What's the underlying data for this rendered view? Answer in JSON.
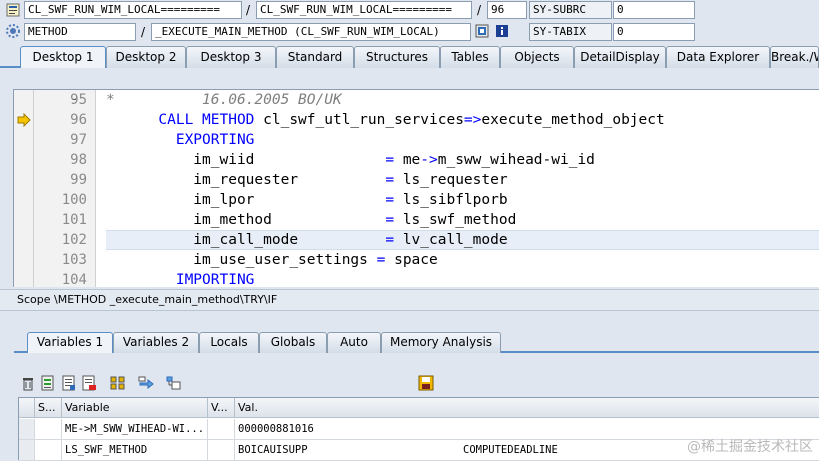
{
  "header": {
    "row1": {
      "field1": "CL_SWF_RUN_WIM_LOCAL=========",
      "sep1": "/",
      "field2": "CL_SWF_RUN_WIM_LOCAL=========",
      "sep2": "/",
      "line": "96",
      "sysvar": "SY-SUBRC",
      "sysval": "0"
    },
    "row2": {
      "type": "METHOD",
      "sep1": "/",
      "name": "_EXECUTE_MAIN_METHOD (CL_SWF_RUN_WIM_LOCAL)",
      "sysvar": "SY-TABIX",
      "sysval": "0"
    }
  },
  "desktop_tabs": [
    "Desktop 1",
    "Desktop 2",
    "Desktop 3",
    "Standard",
    "Structures",
    "Tables",
    "Objects",
    "DetailDisplay",
    "Data Explorer",
    "Break./W"
  ],
  "editor": {
    "lines": [
      {
        "num": "95",
        "marker": "-",
        "parts": [
          {
            "t": "*          16.06.2005 BO/UK",
            "c": "cm"
          }
        ]
      },
      {
        "num": "96",
        "marker": "",
        "parts": [
          {
            "t": "      CALL METHOD",
            "c": "kw"
          },
          {
            "t": " cl_swf_utl_run_services",
            "c": ""
          },
          {
            "t": "=>",
            "c": "op"
          },
          {
            "t": "execute_method_object",
            "c": ""
          }
        ]
      },
      {
        "num": "97",
        "marker": "",
        "parts": [
          {
            "t": "        EXPORTING",
            "c": "kw"
          }
        ]
      },
      {
        "num": "98",
        "marker": "",
        "parts": [
          {
            "t": "          im_wiid               ",
            "c": ""
          },
          {
            "t": "=",
            "c": "op"
          },
          {
            "t": " me",
            "c": ""
          },
          {
            "t": "->",
            "c": "op"
          },
          {
            "t": "m_sww_wihead-wi_id",
            "c": ""
          }
        ]
      },
      {
        "num": "99",
        "marker": "",
        "parts": [
          {
            "t": "          im_requester          ",
            "c": ""
          },
          {
            "t": "=",
            "c": "op"
          },
          {
            "t": " ls_requester",
            "c": ""
          }
        ]
      },
      {
        "num": "100",
        "marker": "",
        "parts": [
          {
            "t": "          im_lpor               ",
            "c": ""
          },
          {
            "t": "=",
            "c": "op"
          },
          {
            "t": " ls_sibflporb",
            "c": ""
          }
        ]
      },
      {
        "num": "101",
        "marker": "",
        "parts": [
          {
            "t": "          im_method             ",
            "c": ""
          },
          {
            "t": "=",
            "c": "op"
          },
          {
            "t": " ls_swf_method",
            "c": ""
          }
        ]
      },
      {
        "num": "102",
        "marker": "",
        "parts": [
          {
            "t": "          im_call_mode          ",
            "c": ""
          },
          {
            "t": "=",
            "c": "op"
          },
          {
            "t": " lv_call_mode",
            "c": ""
          }
        ]
      },
      {
        "num": "103",
        "marker": "",
        "parts": [
          {
            "t": "          im_use_user_settings ",
            "c": ""
          },
          {
            "t": "=",
            "c": "op"
          },
          {
            "t": " space",
            "c": ""
          }
        ]
      },
      {
        "num": "104",
        "marker": "",
        "parts": [
          {
            "t": "        IMPORTING",
            "c": "kw"
          }
        ]
      }
    ]
  },
  "scope": "Scope \\METHOD _execute_main_method\\TRY\\IF",
  "variable_tabs": [
    "Variables 1",
    "Variables 2",
    "Locals",
    "Globals",
    "Auto",
    "Memory Analysis"
  ],
  "grid": {
    "headers": [
      "S...",
      "Variable",
      "V...",
      "Val."
    ],
    "rows": [
      {
        "variable": "ME->M_SWW_WIHEAD-WI...",
        "value": "000000881016",
        "value2": ""
      },
      {
        "variable": "LS_SWF_METHOD",
        "value": "BOICAUISUPP",
        "value2": "COMPUTEDEADLINE"
      }
    ]
  },
  "watermark": "@稀土掘金技术社区"
}
